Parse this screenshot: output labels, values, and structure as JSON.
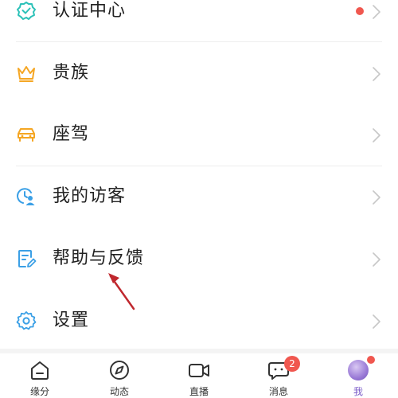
{
  "menu": {
    "items": [
      {
        "label": "认证中心",
        "icon": "verified-badge-icon",
        "has_dot": true
      },
      {
        "label": "贵族",
        "icon": "crown-icon"
      },
      {
        "label": "座驾",
        "icon": "car-icon"
      },
      {
        "label": "我的访客",
        "icon": "visitor-clock-icon"
      },
      {
        "label": "帮助与反馈",
        "icon": "feedback-edit-icon"
      },
      {
        "label": "设置",
        "icon": "gear-icon"
      }
    ]
  },
  "tabbar": {
    "tabs": [
      {
        "label": "缘分",
        "icon": "home-icon"
      },
      {
        "label": "动态",
        "icon": "compass-icon"
      },
      {
        "label": "直播",
        "icon": "video-camera-icon"
      },
      {
        "label": "消息",
        "icon": "chat-icon",
        "badge": "2"
      },
      {
        "label": "我",
        "icon": "avatar",
        "active": true
      }
    ]
  },
  "colors": {
    "teal": "#2cc1b8",
    "orange": "#f5a623",
    "blue": "#3ba0e6",
    "red_dot": "#f0574f",
    "chevron": "#c7c7c7",
    "active_tab": "#7b5cc9"
  }
}
